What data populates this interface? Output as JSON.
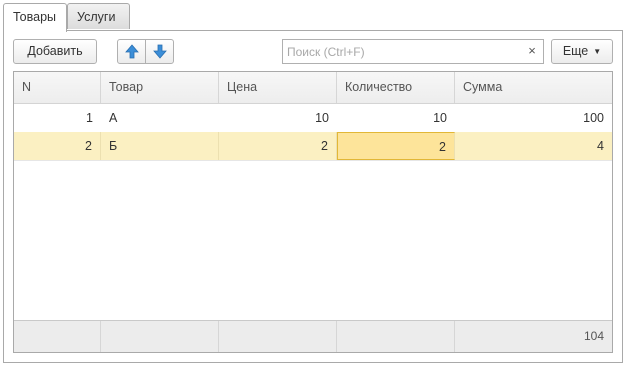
{
  "tabs": [
    {
      "label": "Товары",
      "active": true
    },
    {
      "label": "Услуги",
      "active": false
    }
  ],
  "toolbar": {
    "add_label": "Добавить",
    "up_icon": "arrow-up-icon",
    "down_icon": "arrow-down-icon",
    "search_placeholder": "Поиск (Ctrl+F)",
    "search_value": "",
    "clear_label": "×",
    "more_label": "Еще",
    "accent_color": "#3b8ed8"
  },
  "table": {
    "columns": [
      "N",
      "Товар",
      "Цена",
      "Количество",
      "Сумма"
    ],
    "rows": [
      {
        "n": "1",
        "product": "А",
        "price": "10",
        "quantity": "10",
        "sum": "100"
      },
      {
        "n": "2",
        "product": "Б",
        "price": "2",
        "quantity": "2",
        "sum": "4"
      }
    ],
    "selected_row": 2,
    "footer": {
      "total_sum": "104"
    },
    "selected_row_color": "#fbf0c2",
    "active_cell_color": "#fde49a"
  }
}
